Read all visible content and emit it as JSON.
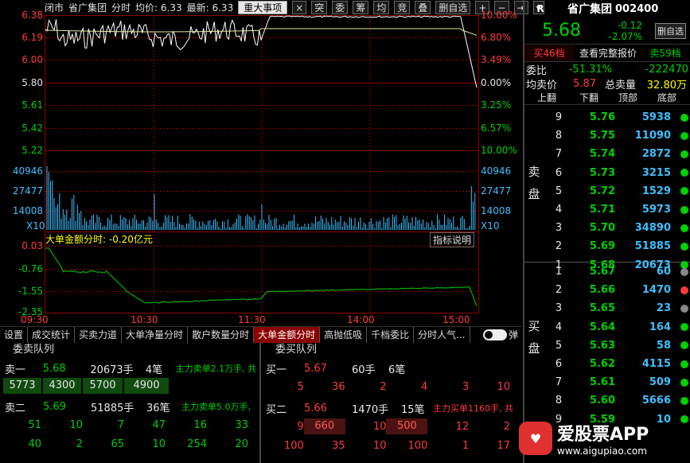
{
  "chart": {
    "toolbar": {
      "items": [
        "闭市",
        "省广集团",
        "分时",
        "均价: 6.33",
        "最新: 6.33"
      ],
      "event_button": "重大事项",
      "buttons": [
        "×",
        "突",
        "委",
        "筹",
        "均",
        "竞",
        "叠",
        "删自选",
        "+",
        "−",
        "⇥",
        "▾"
      ]
    },
    "price_axis_left": [
      "6.38",
      "6.19",
      "6.00",
      "5.80",
      "5.61",
      "5.42",
      "5.22"
    ],
    "price_axis_right": [
      "10.00%",
      "6.80%",
      "3.49%",
      "0.00%",
      "3.25%",
      "6.57%",
      "10.00%"
    ],
    "volume_axis_left": [
      "40946",
      "27477",
      "14008",
      "X10"
    ],
    "volume_axis_right": [
      "40946",
      "27477",
      "14008",
      "X10"
    ],
    "indicator": {
      "title": "大单金额分时: -0.20亿元",
      "help_button": "指标说明",
      "axis": [
        "0.03",
        "-0.76",
        "-1.55",
        "-2.35"
      ]
    },
    "time_labels": [
      "09:30",
      "10:30",
      "11:30",
      "14:00",
      "15:00"
    ]
  },
  "tabs": {
    "items": [
      "设置",
      "成交统计",
      "买卖力道",
      "大单净量分时",
      "散户数量分时",
      "大单金额分时",
      "高抛低吸",
      "千档委比",
      "分时人气..."
    ],
    "active_index": 5,
    "toggle_label": "弹"
  },
  "sell_queue": {
    "header": "委卖队列",
    "levels": [
      {
        "label": "卖一",
        "price": "5.68",
        "volume": "20673手",
        "count": "4笔",
        "note": "主力卖单2.1万手, 共",
        "orders": [
          "5773",
          "4300",
          "5700",
          "4900"
        ]
      },
      {
        "label": "卖二",
        "price": "5.69",
        "volume": "51885手",
        "count": "36笔",
        "note": "主力卖单5.0万手,",
        "orders": [
          "51",
          "10",
          "7",
          "47",
          "16",
          "33"
        ],
        "orders2": [
          "40",
          "2",
          "65",
          "10",
          "254",
          "20"
        ]
      }
    ]
  },
  "buy_queue": {
    "header": "委买队列",
    "levels": [
      {
        "label": "买一",
        "price": "5.67",
        "volume": "60手",
        "count": "6笔",
        "orders": [
          "5",
          "36",
          "2",
          "4",
          "3",
          "10"
        ]
      },
      {
        "label": "买二",
        "price": "5.66",
        "volume": "1470手",
        "count": "15笔",
        "note": "主力买单1160手, 共",
        "orders": [
          "9",
          "660",
          "10",
          "500",
          "12",
          "2"
        ],
        "orders2": [
          "100",
          "35",
          "10",
          "100",
          "1",
          "17"
        ]
      }
    ]
  },
  "quote": {
    "market_tag": "R",
    "name": "省广集团",
    "code": "002400",
    "price": "5.68",
    "change": "-0.12",
    "change_pct": "-2.07%",
    "remove_button": "删自选",
    "buy_levels_btn": "买46档",
    "full_order_btn": "查看完整报价",
    "sell_levels_btn": "卖59档",
    "weibi_label": "委比",
    "weibi_pct": "-51.31%",
    "weibi_diff": "-222470",
    "avg_sell_label": "均卖价",
    "avg_sell": "5.87",
    "total_sell_label": "总卖量",
    "total_sell": "32.80万",
    "col_headers": [
      "上翻",
      "下翻",
      "顶部",
      "底部"
    ],
    "sell_side_label": [
      "卖",
      "盘"
    ],
    "buy_side_label": [
      "买",
      "盘"
    ],
    "sells": [
      {
        "idx": "9",
        "price": "5.76",
        "vol": "5938"
      },
      {
        "idx": "8",
        "price": "5.75",
        "vol": "11090"
      },
      {
        "idx": "7",
        "price": "5.74",
        "vol": "2872"
      },
      {
        "idx": "6",
        "price": "5.73",
        "vol": "3215"
      },
      {
        "idx": "5",
        "price": "5.72",
        "vol": "1529"
      },
      {
        "idx": "4",
        "price": "5.71",
        "vol": "5973"
      },
      {
        "idx": "3",
        "price": "5.70",
        "vol": "34890"
      },
      {
        "idx": "2",
        "price": "5.69",
        "vol": "51885"
      },
      {
        "idx": "1",
        "price": "5.68",
        "vol": "20673"
      }
    ],
    "buys": [
      {
        "idx": "1",
        "price": "5.67",
        "vol": "60",
        "dot": "#888888"
      },
      {
        "idx": "2",
        "price": "5.66",
        "vol": "1470",
        "dot": "#ff3b3b"
      },
      {
        "idx": "3",
        "price": "5.65",
        "vol": "23",
        "dot": "#888888"
      },
      {
        "idx": "4",
        "price": "5.64",
        "vol": "164",
        "dot": "#00d000"
      },
      {
        "idx": "5",
        "price": "5.63",
        "vol": "58",
        "dot": "#00d000"
      },
      {
        "idx": "6",
        "price": "5.62",
        "vol": "4115",
        "dot": "#00d000"
      },
      {
        "idx": "7",
        "price": "5.61",
        "vol": "509",
        "dot": "#00d000"
      },
      {
        "idx": "8",
        "price": "5.60",
        "vol": "5666",
        "dot": "#00d000"
      },
      {
        "idx": "9",
        "price": "5.59",
        "vol": "10",
        "dot": "#00d000"
      }
    ]
  },
  "watermark": {
    "brand": "爱股票APP",
    "url": "www.aigupiao.com"
  },
  "colors": {
    "up": "#ff3b3b",
    "down": "#00d000",
    "vol": "#3fbfff",
    "accent": "#8b0000"
  }
}
